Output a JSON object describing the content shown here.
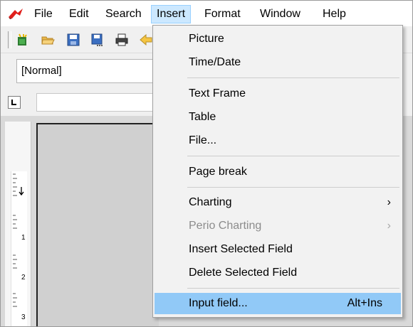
{
  "menubar": {
    "items": [
      {
        "label": "File"
      },
      {
        "label": "Edit"
      },
      {
        "label": "Search"
      },
      {
        "label": "Insert"
      },
      {
        "label": "Format"
      },
      {
        "label": "Window"
      },
      {
        "label": "Help"
      }
    ]
  },
  "stylebar": {
    "style_value": "[Normal]"
  },
  "insert_menu": {
    "items": [
      {
        "label": "Picture"
      },
      {
        "label": "Time/Date"
      },
      {
        "label": "Text Frame"
      },
      {
        "label": "Table"
      },
      {
        "label": "File..."
      },
      {
        "label": "Page break"
      },
      {
        "label": "Charting",
        "submenu": true
      },
      {
        "label": "Perio Charting",
        "submenu": true,
        "disabled": true
      },
      {
        "label": "Insert Selected Field"
      },
      {
        "label": "Delete Selected Field"
      },
      {
        "label": "Input field...",
        "shortcut": "Alt+Ins",
        "highlighted": true
      }
    ],
    "submenu_glyph": "›"
  },
  "ruler": {
    "numbers": [
      "1",
      "2",
      "3"
    ]
  },
  "colors": {
    "menu_highlight": "#91c9f7",
    "active_menu_bg": "#cce8ff",
    "disabled_text": "#8c8c8c"
  }
}
